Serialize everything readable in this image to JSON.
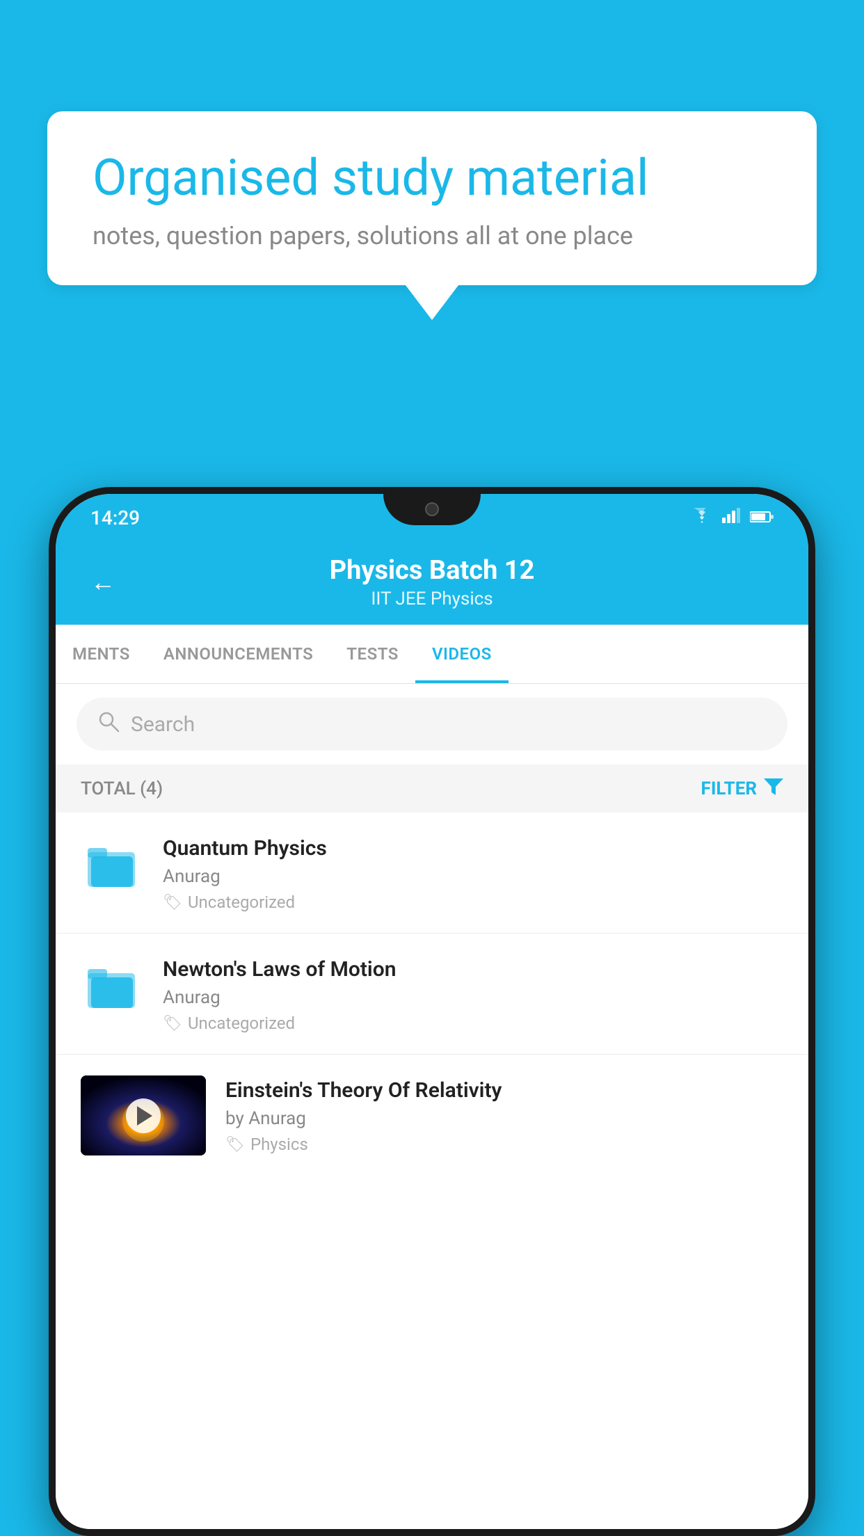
{
  "background_color": "#1ab8e8",
  "speech_bubble": {
    "title": "Organised study material",
    "subtitle": "notes, question papers, solutions all at one place"
  },
  "status_bar": {
    "time": "14:29",
    "icons": [
      "wifi",
      "signal",
      "battery"
    ]
  },
  "app_header": {
    "title": "Physics Batch 12",
    "subtitle": "IIT JEE   Physics",
    "back_label": "←"
  },
  "tabs": [
    {
      "label": "MENTS",
      "active": false
    },
    {
      "label": "ANNOUNCEMENTS",
      "active": false
    },
    {
      "label": "TESTS",
      "active": false
    },
    {
      "label": "VIDEOS",
      "active": true
    }
  ],
  "search": {
    "placeholder": "Search"
  },
  "filter_bar": {
    "total_label": "TOTAL (4)",
    "filter_label": "FILTER"
  },
  "videos": [
    {
      "title": "Quantum Physics",
      "author": "Anurag",
      "tag": "Uncategorized",
      "type": "folder"
    },
    {
      "title": "Newton's Laws of Motion",
      "author": "Anurag",
      "tag": "Uncategorized",
      "type": "folder"
    },
    {
      "title": "Einstein's Theory Of Relativity",
      "author": "by Anurag",
      "tag": "Physics",
      "type": "video"
    }
  ]
}
